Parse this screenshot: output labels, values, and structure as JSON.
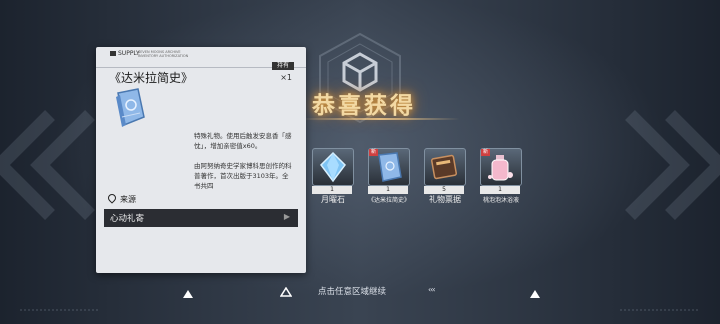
{
  "title": "恭喜获得",
  "item_card": {
    "supply_label": "SUPPLY",
    "fine_print": "SEVEN MOONS ARCHIVE INVENTORY AUTHORIZATION",
    "owned_badge": "持有",
    "name": "《达米拉简史》",
    "quantity": "×1",
    "description": "特殊礼物。使用后触发安息香「感忱」，增加亲密值x60。",
    "lore": "由阿努纳奇史学家博科思创作的科普著作，首次出版于3103年。全书共四",
    "source_label": "来源",
    "source_item": "心动礼寄"
  },
  "rewards": [
    {
      "label": "月曜石",
      "count": "1",
      "new": false,
      "icon": "crystal-icon"
    },
    {
      "label": "《达米拉简史》",
      "count": "1",
      "new": true,
      "new_text": "新",
      "icon": "book-icon"
    },
    {
      "label": "礼物票据",
      "count": "5",
      "new": false,
      "icon": "ticket-icon"
    },
    {
      "label": "桃泡泡沐浴液",
      "count": "1",
      "new": true,
      "new_text": "新",
      "icon": "bottle-icon"
    }
  ],
  "bottom_hint": "点击任意区域继续",
  "skip_symbol": "‹‹‹",
  "colors": {
    "title_gold": "#f3d9a3",
    "card_bg": "#e6e8ec",
    "source_row": "#2b2d33"
  }
}
